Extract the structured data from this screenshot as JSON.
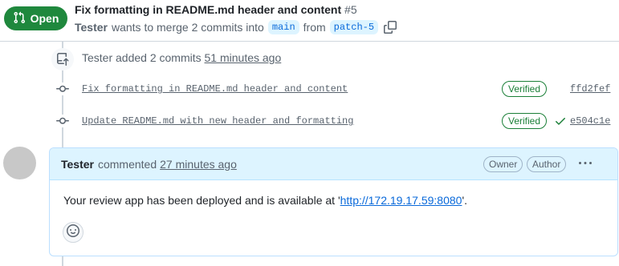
{
  "header": {
    "state": "Open",
    "title": "Fix formatting in README.md header and content",
    "number": "#5",
    "author": "Tester",
    "merge_text": "wants to merge 2 commits into",
    "base_branch": "main",
    "from_text": "from",
    "head_branch": "patch-5"
  },
  "timeline": {
    "event": {
      "author": "Tester",
      "action": "added 2 commits",
      "time": "51 minutes ago"
    },
    "commits": [
      {
        "message": "Fix formatting in README.md header and content",
        "verified": "Verified",
        "sha": "ffd2fef",
        "check": false
      },
      {
        "message": "Update README.md with new header and formatting",
        "verified": "Verified",
        "sha": "e504c1e",
        "check": true
      }
    ]
  },
  "comment": {
    "author": "Tester",
    "verb": "commented",
    "time": "27 minutes ago",
    "roles": [
      "Owner",
      "Author"
    ],
    "body_prefix": "Your review app has been deployed and is available at '",
    "link": "http://172.19.17.59:8080",
    "body_suffix": "'."
  },
  "colors": {
    "open_green": "#1f883d",
    "link_blue": "#0969da",
    "comment_header_bg": "#ddf4ff",
    "verified_green": "#1a7f37"
  },
  "icons": {
    "state": "git-pull-request-icon",
    "copy": "copy-icon",
    "event": "repo-push-icon",
    "commit": "git-commit-icon",
    "check": "check-icon",
    "kebab": "kebab-horizontal-icon",
    "reaction": "smiley-icon"
  }
}
